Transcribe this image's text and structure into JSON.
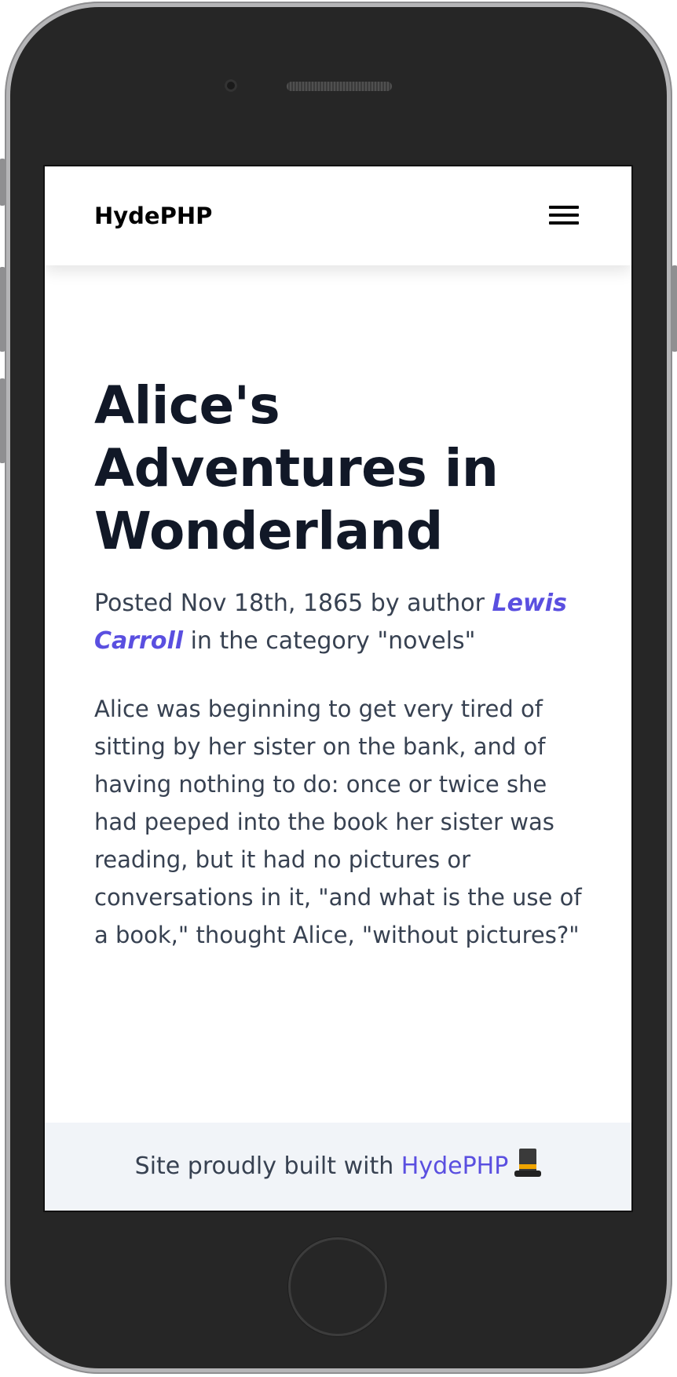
{
  "navbar": {
    "brand": "HydePHP",
    "menu_icon": "hamburger-menu-icon"
  },
  "post": {
    "title": "Alice's Adventures in Wonderland",
    "meta_prefix": "Posted Nov 18th, 1865 by author ",
    "author": "Lewis Carroll",
    "meta_suffix": " in the category \"novels\"",
    "body": "Alice was beginning to get very tired of sitting by her sister on the bank, and of having nothing to do: once or twice she had peeped into the book her sister was reading, but it had no pictures or conversations in it, \"and what is the use of a book,\" thought Alice, \"without pictures?\""
  },
  "footer": {
    "prefix": "Site proudly built with ",
    "link": "HydePHP",
    "icon": "top-hat-icon"
  },
  "colors": {
    "accent": "#5a4fe0",
    "title": "#111827",
    "text": "#374151",
    "footer_bg": "#f1f4f8"
  }
}
